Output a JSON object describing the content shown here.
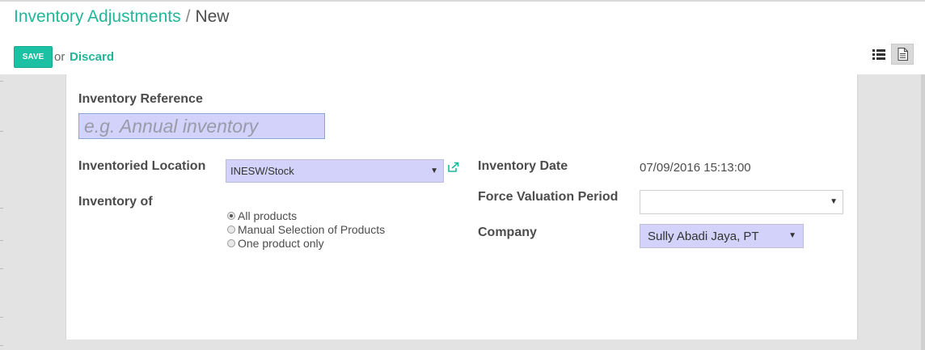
{
  "breadcrumb": {
    "parent": "Inventory Adjustments",
    "separator": "/",
    "current": "New"
  },
  "toolbar": {
    "save_label": "SAVE",
    "or_text": "or",
    "discard_label": "Discard"
  },
  "form": {
    "reference_label": "Inventory Reference",
    "reference_placeholder": "e.g. Annual inventory",
    "location_label": "Inventoried Location",
    "location_value": "INESW/Stock",
    "inventory_of_label": "Inventory of",
    "inventory_of_options": [
      "All products",
      "Manual Selection of Products",
      "One product only"
    ],
    "inventory_of_selected": "All products",
    "date_label": "Inventory Date",
    "date_value": "07/09/2016 15:13:00",
    "period_label": "Force Valuation Period",
    "period_value": "",
    "company_label": "Company",
    "company_value": "Sully Abadi Jaya, PT"
  },
  "icons": {
    "dropdown": "caret-down-icon",
    "external": "external-link-icon",
    "list_view": "list-view-icon",
    "form_view": "form-view-icon"
  },
  "colors": {
    "accent": "#21b799",
    "required_field": "#d2d2fb",
    "sheet_background": "#e3e3e3"
  }
}
